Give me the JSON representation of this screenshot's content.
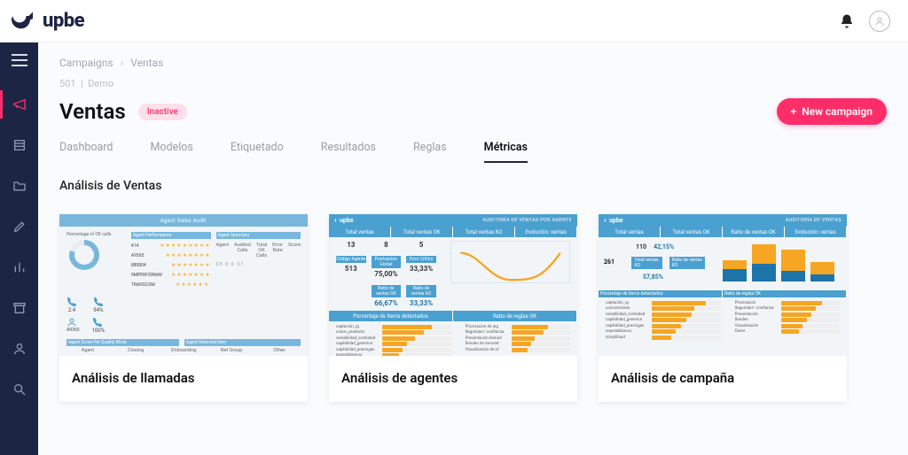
{
  "brand": {
    "name": "upbe"
  },
  "breadcrumb": {
    "root": "Campaigns",
    "current": "Ventas"
  },
  "meta": {
    "id": "501",
    "env": "Demo"
  },
  "title": "Ventas",
  "status": {
    "label": "Inactive"
  },
  "actions": {
    "new_campaign": "New campaign"
  },
  "tabs": [
    {
      "label": "Dashboard",
      "active": false
    },
    {
      "label": "Modelos",
      "active": false
    },
    {
      "label": "Etiquetado",
      "active": false
    },
    {
      "label": "Resultados",
      "active": false
    },
    {
      "label": "Reglas",
      "active": false
    },
    {
      "label": "Métricas",
      "active": true
    }
  ],
  "section_title": "Análisis de Ventas",
  "cards": [
    {
      "title": "Análisis de llamadas"
    },
    {
      "title": "Análisis de agentes"
    },
    {
      "title": "Análisis de campaña"
    }
  ],
  "thumbs": {
    "card1": {
      "header": "Agent Sales Audit",
      "left_caption": "Percentage of OK calls",
      "perf_caption": "Agent Performance",
      "summary_caption": "Agent Summary",
      "summary_cols": [
        "Agent",
        "Audited Calls",
        "Total OK Calls",
        "Error Rate",
        "Score"
      ],
      "perf_rows": [
        {
          "id": "414",
          "stars": 9
        },
        {
          "id": "A9365",
          "stars": 8
        },
        {
          "id": "880804",
          "stars": 7
        },
        {
          "id": "9MPERFORMANCE",
          "stars": 7
        },
        {
          "id": "TRANSCOM",
          "stars": 6
        }
      ],
      "kpis": [
        {
          "v": "2.4"
        },
        {
          "v": "94%"
        },
        {
          "v": "A9365"
        },
        {
          "v": "100%"
        }
      ],
      "bottom_left": "Agent Score Per Quality Block",
      "bottom_right": "Agent Detected Item",
      "bottom_cols": [
        "Agent",
        "Closing",
        "Onboarding",
        "Net Group",
        "Other"
      ]
    },
    "card2": {
      "brand": "upbe",
      "brand_right": "AUDITORÍA DE VENTAS POR AGENTE",
      "strip": [
        "Total ventas",
        "Total ventas OK",
        "Total ventas KO",
        "Evolución: ventas"
      ],
      "m1": {
        "v": "13"
      },
      "m2": {
        "v": "8"
      },
      "m3": {
        "v": "5"
      },
      "pg": {
        "cap": "Puntuación Global",
        "v": "75,00%"
      },
      "ec": {
        "cap": "Error Crítico",
        "v": "33,33%"
      },
      "ca": {
        "cap": "Código Agente",
        "v": "513"
      },
      "rvok": {
        "cap": "Ratio de ventas OK",
        "v": "66,67%"
      },
      "rvko": {
        "cap": "Ratio de ventas KO",
        "v": "33,33%"
      },
      "strip2": [
        "Porcentaje de ítems detectados",
        "Ratio de reglas OK"
      ],
      "bars_left": [
        {
          "label": "captación_rg",
          "pct": 72
        },
        {
          "label": "conoc_producto",
          "pct": 60
        },
        {
          "label": "variabilidad_contratad",
          "pct": 48
        },
        {
          "label": "capibilidad_generica",
          "pct": 36
        },
        {
          "label": "capibilidad_preciogas",
          "pct": 30
        },
        {
          "label": "esperablancos",
          "pct": 25
        }
      ],
      "bars_right": [
        {
          "label": "Priorización de arg",
          "pct": 62
        },
        {
          "label": "Seguridad / confianza",
          "pct": 55
        },
        {
          "label": "Presentación llamad",
          "pct": 40
        },
        {
          "label": "Sondeo de necesid",
          "pct": 33
        },
        {
          "label": "Visualización de of",
          "pct": 28
        }
      ]
    },
    "card3": {
      "brand": "upbe",
      "brand_right": "AUDITORÍA DE VENTAS",
      "strip": [
        "Total ventas",
        "Total ventas OK",
        "Ratio de ventas OK",
        "Evolución: ventas"
      ],
      "kv1": {
        "k": "261",
        "cap_a": "Total ventas KO",
        "cap_b": "Ratio de ventas KO"
      },
      "v1": "110",
      "v2": "42,15%",
      "v3": "57,85%",
      "strip2": [
        "Porcentaje de ítems detectados",
        "Ratio de reglas OK"
      ],
      "bars_left": [
        {
          "label": "captación_rg",
          "pct": 78
        },
        {
          "label": "conocimiento",
          "pct": 62
        },
        {
          "label": "variabilidad_contratad",
          "pct": 58
        },
        {
          "label": "capibilidad_generica",
          "pct": 50
        },
        {
          "label": "capibilidad_preciogas",
          "pct": 42
        },
        {
          "label": "esperablancos",
          "pct": 35
        },
        {
          "label": "simplificad",
          "pct": 28
        }
      ],
      "bars_right": [
        {
          "label": "Priorización",
          "pct": 70
        },
        {
          "label": "Seguridad / confianza",
          "pct": 60
        },
        {
          "label": "Presentación",
          "pct": 52
        },
        {
          "label": "Sondeo",
          "pct": 44
        },
        {
          "label": "Visualización",
          "pct": 36
        },
        {
          "label": "Cierre",
          "pct": 30
        }
      ]
    }
  }
}
